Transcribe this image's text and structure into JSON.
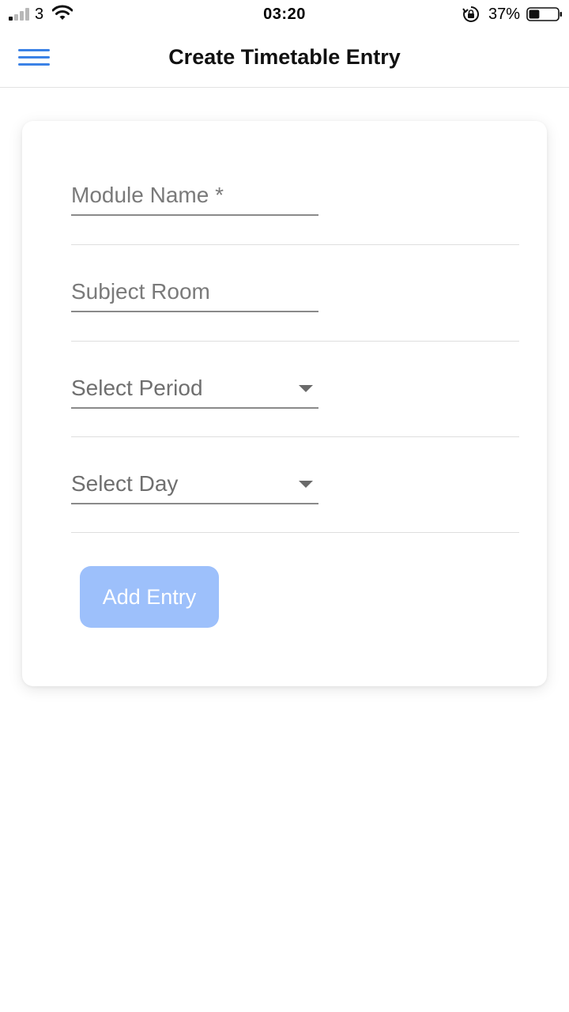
{
  "status_bar": {
    "carrier": "3",
    "time": "03:20",
    "battery_percent": "37%",
    "battery_level": 0.37,
    "icons": [
      "signal-icon",
      "wifi-icon",
      "orientation-lock-icon",
      "battery-icon"
    ]
  },
  "header": {
    "title": "Create Timetable Entry",
    "menu_icon": "hamburger-menu-icon"
  },
  "form": {
    "module_name": {
      "placeholder": "Module Name *",
      "value": ""
    },
    "subject_room": {
      "placeholder": "Subject Room",
      "value": ""
    },
    "period": {
      "selected_label": "Select Period"
    },
    "day": {
      "selected_label": "Select Day"
    },
    "submit_label": "Add Entry"
  },
  "colors": {
    "accent": "#3b82e6",
    "button_disabled": "#9dc0fb",
    "placeholder": "#7a7a7a"
  }
}
